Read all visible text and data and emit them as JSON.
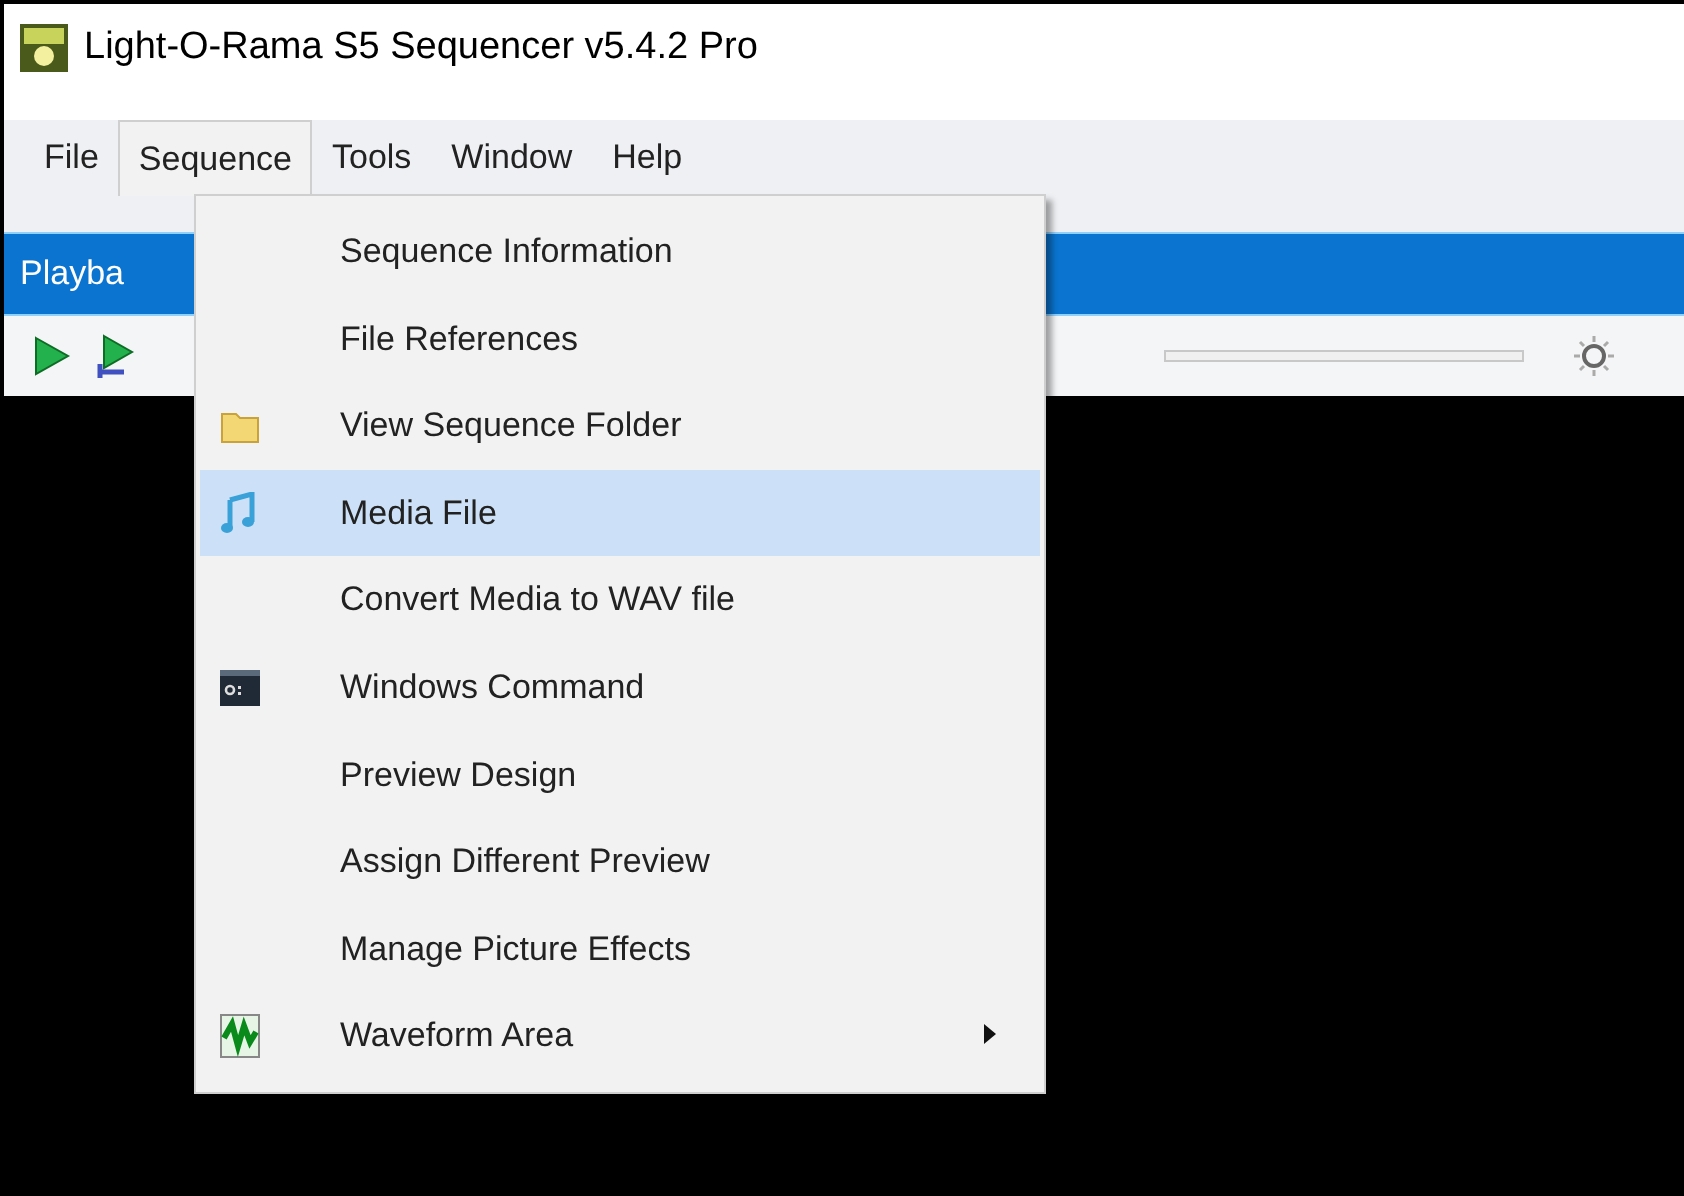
{
  "window": {
    "title": "Light-O-Rama S5 Sequencer v5.4.2 Pro"
  },
  "menu_bar": [
    {
      "label": "File",
      "selected": false
    },
    {
      "label": "Sequence",
      "selected": true
    },
    {
      "label": "Tools",
      "selected": false
    },
    {
      "label": "Window",
      "selected": false
    },
    {
      "label": "Help",
      "selected": false
    }
  ],
  "panel": {
    "title": "Playba"
  },
  "menu": {
    "items": [
      {
        "label": "Sequence Information",
        "kind": "plain",
        "selected": false
      },
      {
        "label": "File References",
        "kind": "plain",
        "selected": false
      },
      {
        "label": "View Sequence Folder",
        "kind": "folder",
        "selected": false
      },
      {
        "label": "Media File",
        "kind": "music",
        "selected": true
      },
      {
        "label": "Convert Media to WAV file",
        "kind": "plain",
        "selected": false
      },
      {
        "label": "Windows Command",
        "kind": "console",
        "selected": false
      },
      {
        "label": "Preview Design",
        "kind": "plain",
        "selected": false
      },
      {
        "label": "Assign Different Preview",
        "kind": "plain",
        "selected": false
      },
      {
        "label": "Manage Picture Effects",
        "kind": "plain",
        "selected": false
      },
      {
        "label": "Waveform Area",
        "kind": "waveform",
        "selected": false,
        "submenu": true
      }
    ]
  }
}
